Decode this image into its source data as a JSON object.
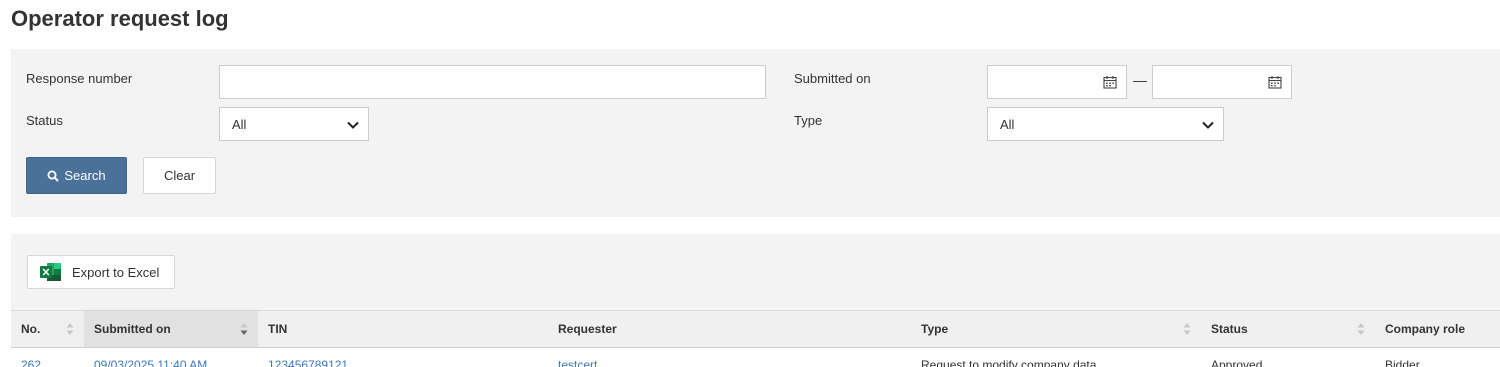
{
  "page": {
    "title": "Operator request log"
  },
  "filters": {
    "response_number": {
      "label": "Response number",
      "value": "",
      "placeholder": ""
    },
    "submitted_on": {
      "label": "Submitted on",
      "from": "",
      "to": "",
      "separator": "—"
    },
    "status": {
      "label": "Status",
      "selected": "All"
    },
    "type": {
      "label": "Type",
      "selected": "All"
    },
    "search_label": "Search",
    "clear_label": "Clear"
  },
  "results": {
    "export_label": "Export to Excel",
    "columns": [
      {
        "label": "No.",
        "sortable": true,
        "sorted": false
      },
      {
        "label": "Submitted on",
        "sortable": true,
        "sorted": true,
        "direction": "desc"
      },
      {
        "label": "TIN",
        "sortable": false,
        "sorted": false
      },
      {
        "label": "Requester",
        "sortable": false,
        "sorted": false
      },
      {
        "label": "Type",
        "sortable": true,
        "sorted": false
      },
      {
        "label": "Status",
        "sortable": true,
        "sorted": false
      },
      {
        "label": "Company role",
        "sortable": false,
        "sorted": false
      }
    ],
    "rows": [
      {
        "no": "262",
        "submitted_on": "09/03/2025 11:40 AM",
        "tin": "123456789121",
        "requester": "testcert",
        "type": "Request to modify company data",
        "status": "Approved",
        "company_role": "Bidder"
      }
    ]
  },
  "colors": {
    "primary_button": "#4a7199",
    "link": "#3b78c3",
    "panel_background": "#f3f3f3",
    "excel_green": "#1d6f42"
  },
  "icons": {
    "search": "magnifier-icon",
    "calendar": "calendar-icon",
    "chevron": "chevron-down-icon",
    "excel": "excel-icon",
    "sort": "sort-arrows-icon"
  }
}
